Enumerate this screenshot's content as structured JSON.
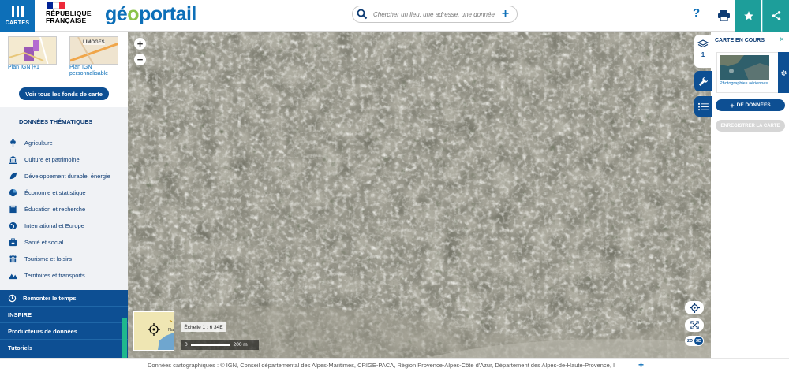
{
  "header": {
    "cartes_label": "CARTES",
    "republique_line1": "RÉPUBLIQUE",
    "republique_line2": "FRANÇAISE",
    "logo_part1": "gé",
    "logo_o": "o",
    "logo_part2": "portail",
    "search_placeholder": "Chercher un lieu, une adresse, une donnée",
    "help_label": "?"
  },
  "sidebar": {
    "fonds": [
      {
        "label": "Plan IGN j+1",
        "thumb_color": "#f3e7c9"
      },
      {
        "label": "Plan IGN personnalisable",
        "thumb_text": "LIMOGES"
      }
    ],
    "voir_tous": "Voir tous les fonds de carte",
    "themes_title": "DONNÉES THÉMATIQUES",
    "themes": [
      {
        "label": "Agriculture",
        "icon": "wheat-icon"
      },
      {
        "label": "Culture et patrimoine",
        "icon": "museum-icon"
      },
      {
        "label": "Développement durable, énergie",
        "icon": "leaf-icon"
      },
      {
        "label": "Économie et statistique",
        "icon": "pie-chart-icon"
      },
      {
        "label": "Éducation et recherche",
        "icon": "book-icon"
      },
      {
        "label": "International et Europe",
        "icon": "globe-icon"
      },
      {
        "label": "Santé et social",
        "icon": "medical-icon"
      },
      {
        "label": "Tourisme et loisirs",
        "icon": "people-icon"
      },
      {
        "label": "Territoires et transports",
        "icon": "mountain-icon"
      }
    ],
    "bottom": [
      {
        "label": "Remonter le temps"
      },
      {
        "label": "INSPIRE"
      },
      {
        "label": "Producteurs de données"
      },
      {
        "label": "Tutoriels"
      }
    ]
  },
  "map": {
    "zoom_in": "+",
    "zoom_out": "−",
    "scale_ratio": "Échelle 1 : 6 34E",
    "scale_distance": "0",
    "scale_distance_end": "200 m",
    "overview_label": "Na",
    "mode_2d": "2D",
    "mode_3d": "3D"
  },
  "panel": {
    "layer_count": "1",
    "title": "CARTE EN COURS",
    "close": "×",
    "layer_name": "Photographies aériennes",
    "add_data": "DE DONNÉES",
    "add_plus": "+",
    "save_map": "ENREGISTRER LA CARTE"
  },
  "attribution": {
    "text": "Données cartographiques : ©    IGN, Conseil départemental des Alpes-Maritimes, CRIGE-PACA, Région Provence-Alpes-Côte d'Azur, Département des Alpes-de-Haute-Provence, I",
    "more": "+"
  },
  "colors": {
    "primary_blue": "#0d4f93",
    "accent_teal": "#1d9e9a",
    "logo_green": "#8bc34a"
  }
}
